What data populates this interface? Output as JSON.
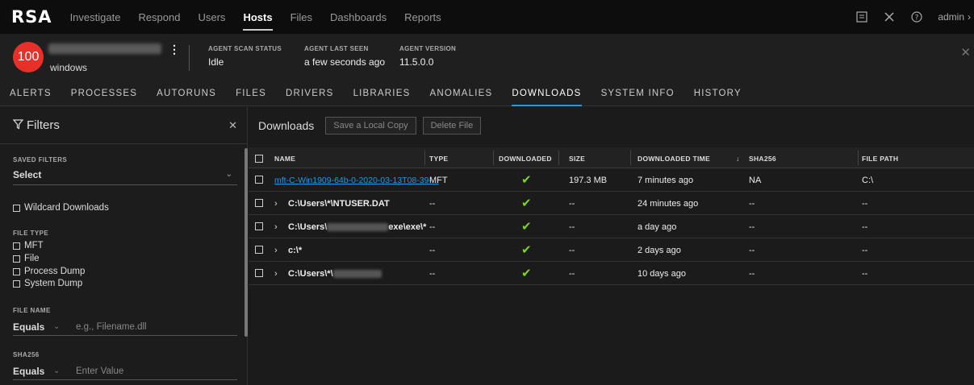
{
  "app": {
    "logo": "RSA"
  },
  "nav": {
    "items": [
      "Investigate",
      "Respond",
      "Users",
      "Hosts",
      "Files",
      "Dashboards",
      "Reports"
    ],
    "active": "Hosts",
    "user": "admin"
  },
  "host": {
    "risk_score": "100",
    "os": "windows",
    "scan_status_label": "AGENT SCAN STATUS",
    "scan_status": "Idle",
    "last_seen_label": "AGENT LAST SEEN",
    "last_seen": "a few seconds ago",
    "version_label": "AGENT VERSION",
    "version": "11.5.0.0"
  },
  "tabs": [
    "ALERTS",
    "PROCESSES",
    "AUTORUNS",
    "FILES",
    "DRIVERS",
    "LIBRARIES",
    "ANOMALIES",
    "DOWNLOADS",
    "SYSTEM INFO",
    "HISTORY"
  ],
  "active_tab": "DOWNLOADS",
  "filters": {
    "title": "Filters",
    "saved_filters_label": "SAVED FILTERS",
    "saved_filters_value": "Select",
    "wildcard": "Wildcard Downloads",
    "file_type_label": "FILE TYPE",
    "file_types": [
      "MFT",
      "File",
      "Process Dump",
      "System Dump"
    ],
    "file_name_label": "FILE NAME",
    "file_name_op": "Equals",
    "file_name_placeholder": "e.g., Filename.dll",
    "sha256_label": "SHA256",
    "sha256_op": "Equals",
    "sha256_placeholder": "Enter Value"
  },
  "downloads": {
    "title": "Downloads",
    "save_button": "Save a Local Copy",
    "delete_button": "Delete File",
    "columns": [
      "NAME",
      "TYPE",
      "DOWNLOADED",
      "SIZE",
      "DOWNLOADED TIME",
      "SHA256",
      "FILE PATH"
    ],
    "rows": [
      {
        "name": "mft-C-Win1909-64b-0-2020-03-13T08-39-...",
        "type": "MFT",
        "downloaded": "✔",
        "size": "197.3 MB",
        "time": "7 minutes ago",
        "sha256": "NA",
        "path": "C:\\"
      },
      {
        "name": "C:\\Users\\*\\NTUSER.DAT",
        "type": "--",
        "downloaded": "✔",
        "size": "--",
        "time": "24 minutes ago",
        "sha256": "--",
        "path": "--"
      },
      {
        "name_prefix": "C:\\Users\\",
        "name_suffix": "exe\\exe\\*",
        "type": "--",
        "downloaded": "✔",
        "size": "--",
        "time": "a day ago",
        "sha256": "--",
        "path": "--"
      },
      {
        "name": "c:\\*",
        "type": "--",
        "downloaded": "✔",
        "size": "--",
        "time": "2 days ago",
        "sha256": "--",
        "path": "--"
      },
      {
        "name_prefix": "C:\\Users\\*\\",
        "type": "--",
        "downloaded": "✔",
        "size": "--",
        "time": "10 days ago",
        "sha256": "--",
        "path": "--"
      }
    ]
  }
}
